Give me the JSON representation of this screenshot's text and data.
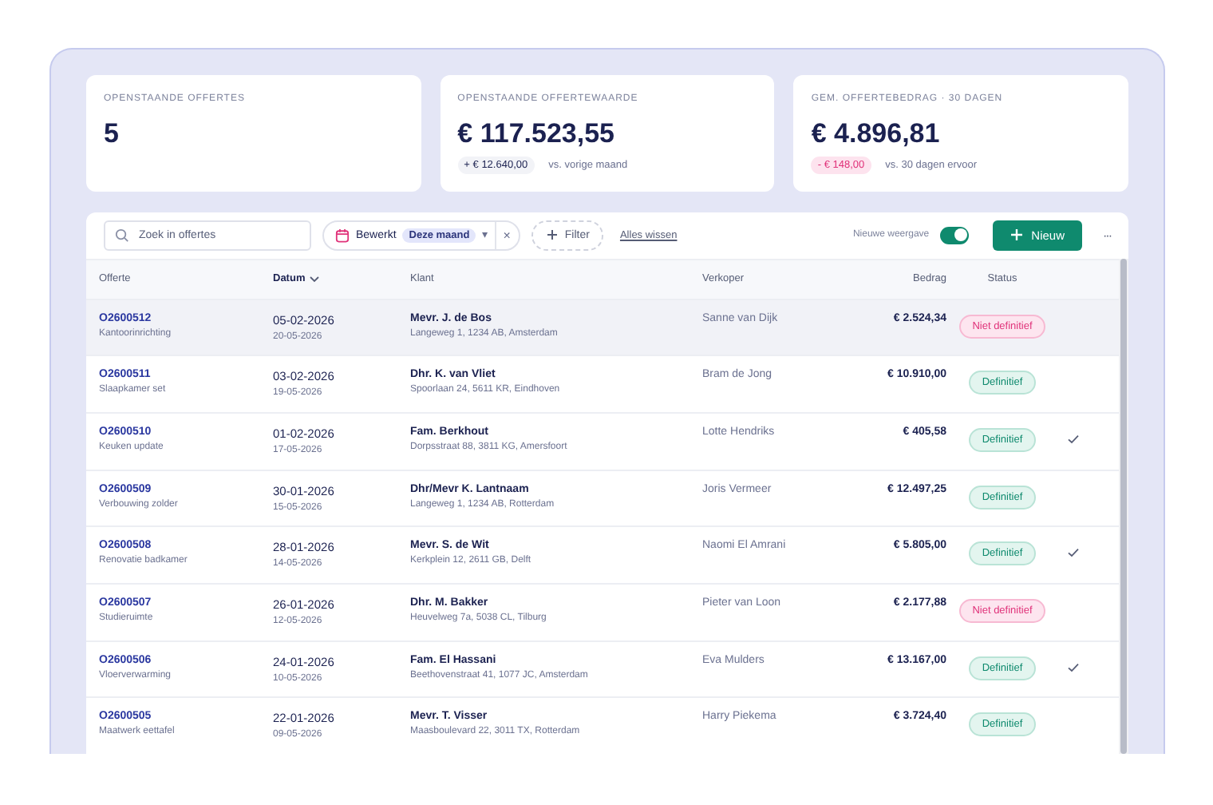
{
  "stats": [
    {
      "label": "OPENSTAANDE OFFERTES",
      "value": "5"
    },
    {
      "label": "OPENSTAANDE OFFERTEWAARDE",
      "value": "€ 117.523,55",
      "delta": "+ € 12.640,00",
      "negative": false,
      "note": "vs. vorige maand"
    },
    {
      "label": "GEM. OFFERTEBEDRAG · 30 DAGEN",
      "value": "€ 4.896,81",
      "delta": "- € 148,00",
      "negative": true,
      "note": "vs. 30 dagen ervoor"
    }
  ],
  "toolbar": {
    "search": {
      "placeholder": "Zoek in offertes"
    },
    "filter_chip": {
      "label": "Bewerkt",
      "value": "Deze maand",
      "caret": "▾",
      "clear": "×"
    },
    "add_filter": "Filter",
    "clear_all": "Alles wissen",
    "view_toggle": {
      "label": "Nieuwe weergave",
      "on": true
    },
    "new_button": "Nieuw",
    "more": "···"
  },
  "table": {
    "columns": [
      {
        "label": "Offerte",
        "sorted": false
      },
      {
        "label": "Datum",
        "sorted": true
      },
      {
        "label": "Klant",
        "sorted": false
      },
      {
        "label": "Verkoper",
        "sorted": false
      },
      {
        "label": "Bedrag",
        "sorted": false
      },
      {
        "label": "Status",
        "sorted": false
      }
    ],
    "rows": [
      {
        "number": "O2600512",
        "subject": "Kantoorinrichting",
        "date": "05-02-2026",
        "valid_until": "20-05-2026",
        "client": "Mevr. J. de Bos",
        "address": "Langeweg 1, 1234 AB, Amsterdam",
        "seller": "Sanne van Dijk",
        "amount": "€ 2.524,34",
        "status": "Niet definitief",
        "kind": "draft",
        "checked": false,
        "selected": true
      },
      {
        "number": "O2600511",
        "subject": "Slaapkamer set",
        "date": "03-02-2026",
        "valid_until": "19-05-2026",
        "client": "Dhr. K. van Vliet",
        "address": "Spoorlaan 24, 5611 KR, Eindhoven",
        "seller": "Bram de Jong",
        "amount": "€ 10.910,00",
        "status": "Definitief",
        "kind": "final",
        "checked": false,
        "selected": false
      },
      {
        "number": "O2600510",
        "subject": "Keuken update",
        "date": "01-02-2026",
        "valid_until": "17-05-2026",
        "client": "Fam. Berkhout",
        "address": "Dorpsstraat 88, 3811 KG, Amersfoort",
        "seller": "Lotte Hendriks",
        "amount": "€ 405,58",
        "status": "Definitief",
        "kind": "final",
        "checked": true,
        "selected": false
      },
      {
        "number": "O2600509",
        "subject": "Verbouwing zolder",
        "date": "30-01-2026",
        "valid_until": "15-05-2026",
        "client": "Dhr/Mevr K. Lantnaam",
        "address": "Langeweg 1, 1234 AB, Rotterdam",
        "seller": "Joris Vermeer",
        "amount": "€ 12.497,25",
        "status": "Definitief",
        "kind": "final",
        "checked": false,
        "selected": false
      },
      {
        "number": "O2600508",
        "subject": "Renovatie badkamer",
        "date": "28-01-2026",
        "valid_until": "14-05-2026",
        "client": "Mevr. S. de Wit",
        "address": "Kerkplein 12, 2611 GB, Delft",
        "seller": "Naomi El Amrani",
        "amount": "€ 5.805,00",
        "status": "Definitief",
        "kind": "final",
        "checked": true,
        "selected": false
      },
      {
        "number": "O2600507",
        "subject": "Studieruimte",
        "date": "26-01-2026",
        "valid_until": "12-05-2026",
        "client": "Dhr. M. Bakker",
        "address": "Heuvelweg 7a, 5038 CL, Tilburg",
        "seller": "Pieter van Loon",
        "amount": "€ 2.177,88",
        "status": "Niet definitief",
        "kind": "draft",
        "checked": false,
        "selected": false
      },
      {
        "number": "O2600506",
        "subject": "Vloerverwarming",
        "date": "24-01-2026",
        "valid_until": "10-05-2026",
        "client": "Fam. El Hassani",
        "address": "Beethovenstraat 41, 1077 JC, Amsterdam",
        "seller": "Eva Mulders",
        "amount": "€ 13.167,00",
        "status": "Definitief",
        "kind": "final",
        "checked": true,
        "selected": false
      },
      {
        "number": "O2600505",
        "subject": "Maatwerk eettafel",
        "date": "22-01-2026",
        "valid_until": "09-05-2026",
        "client": "Mevr. T. Visser",
        "address": "Maasboulevard 22, 3011 TX, Rotterdam",
        "seller": "Harry Piekema",
        "amount": "€ 3.724,40",
        "status": "Definitief",
        "kind": "final",
        "checked": false,
        "selected": false
      }
    ]
  }
}
